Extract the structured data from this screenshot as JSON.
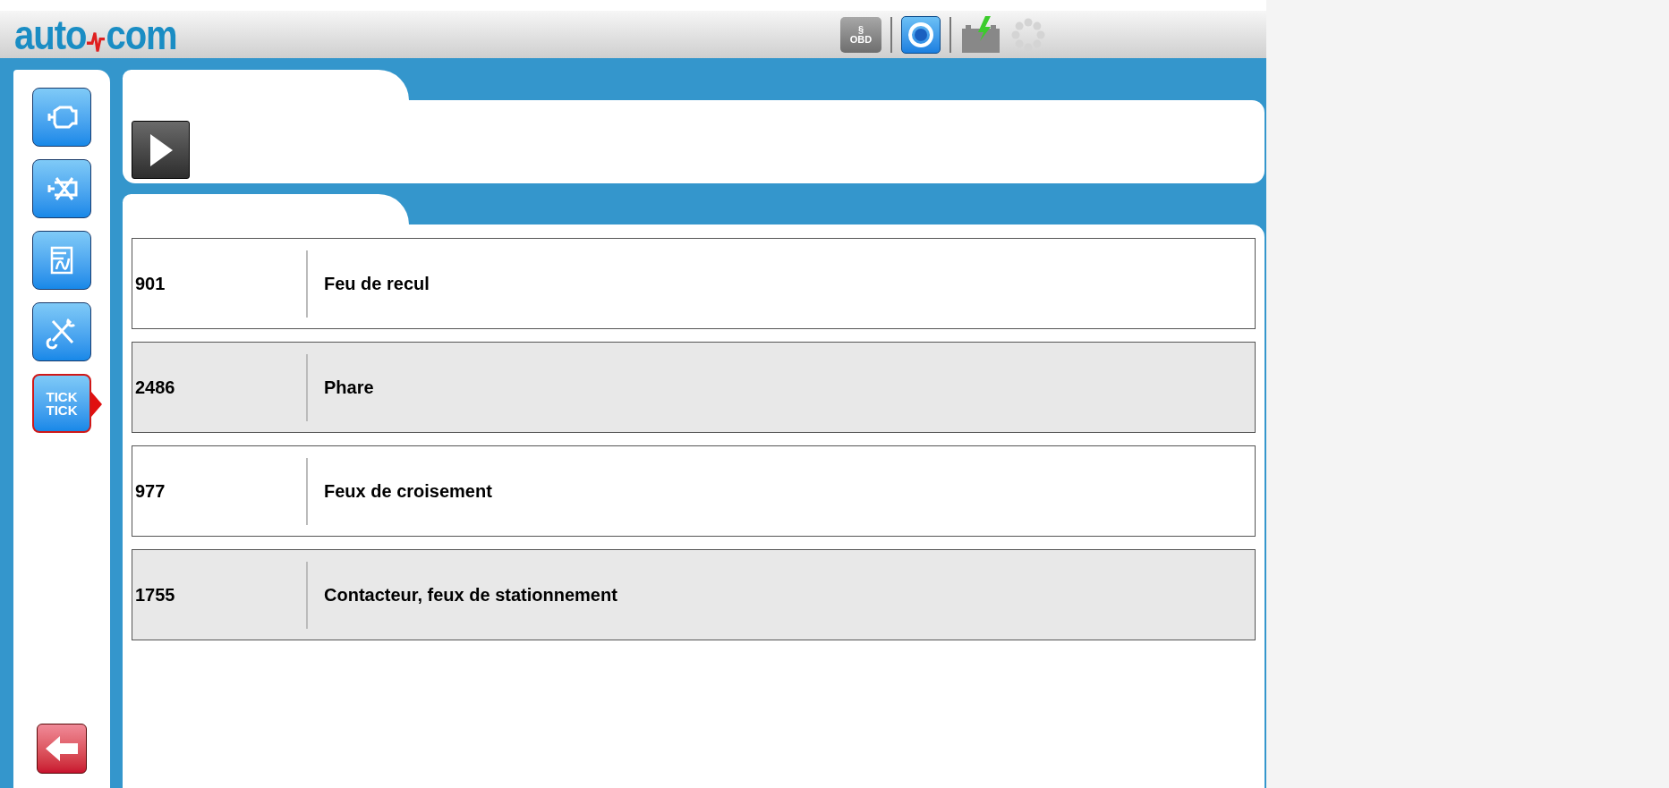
{
  "header": {
    "logo": {
      "left": "auto",
      "right": "com"
    },
    "status_icons": [
      {
        "kind": "obd",
        "label": "§",
        "sublabel": "OBD"
      },
      {
        "kind": "help"
      },
      {
        "kind": "battery"
      },
      {
        "kind": "spinner"
      }
    ]
  },
  "sidebar": {
    "items": [
      {
        "kind": "engine",
        "selected": false
      },
      {
        "kind": "engine-off",
        "selected": false
      },
      {
        "kind": "graph",
        "selected": false
      },
      {
        "kind": "tools",
        "selected": false
      },
      {
        "kind": "tick",
        "label": "TICK",
        "label2": "TICK",
        "selected": true
      }
    ],
    "back": {
      "kind": "back"
    }
  },
  "rows": [
    {
      "code": "901",
      "name": "Feu de recul"
    },
    {
      "code": "2486",
      "name": "Phare"
    },
    {
      "code": "977",
      "name": "Feux de croisement"
    },
    {
      "code": "1755",
      "name": "Contacteur, feux de stationnement"
    }
  ]
}
